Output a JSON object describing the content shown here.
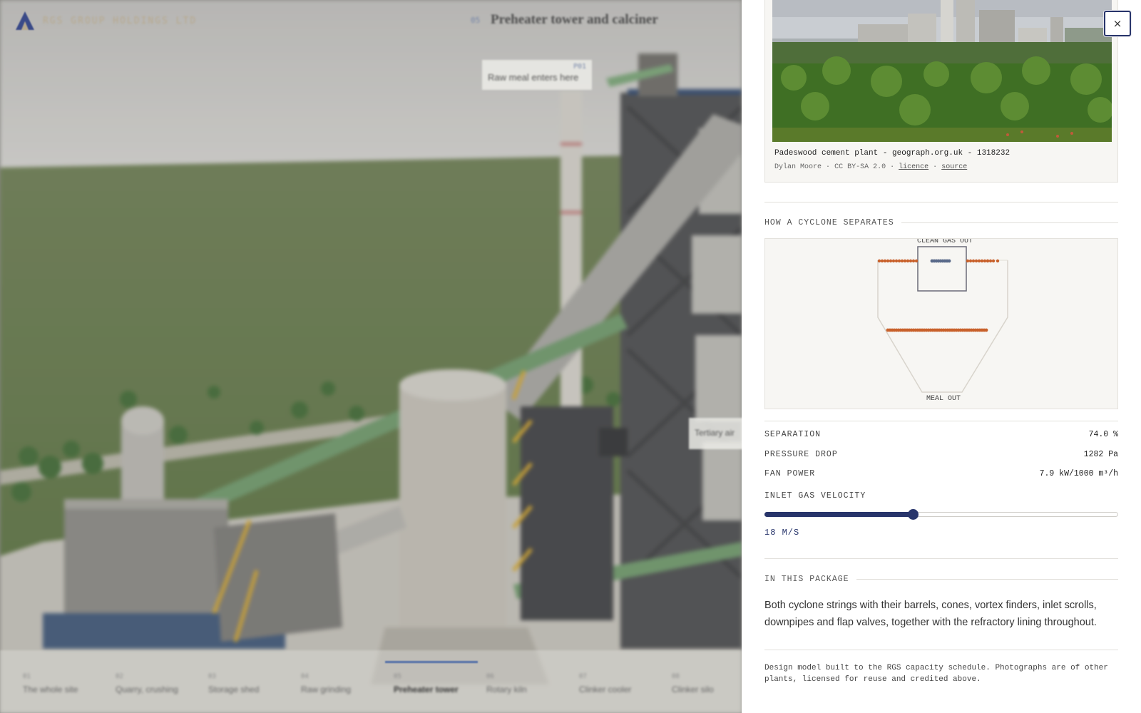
{
  "header": {
    "brand": "RGS GROUP HOLDINGS LTD",
    "section_number": "05",
    "section_title": "Preheater tower and calciner"
  },
  "callouts": [
    {
      "number": "P01",
      "text": "Raw meal enters here"
    },
    {
      "number": "",
      "text": "Tertiary air"
    }
  ],
  "bottom_nav": [
    {
      "number": "01",
      "label": "The whole site"
    },
    {
      "number": "02",
      "label": "Quarry, crushing"
    },
    {
      "number": "03",
      "label": "Storage shed"
    },
    {
      "number": "04",
      "label": "Raw grinding"
    },
    {
      "number": "05",
      "label": "Preheater tower"
    },
    {
      "number": "06",
      "label": "Rotary kiln"
    },
    {
      "number": "07",
      "label": "Clinker cooler"
    },
    {
      "number": "08",
      "label": "Clinker silo"
    }
  ],
  "active_nav_index": 4,
  "photo": {
    "caption": "Padeswood cement plant - geograph.org.uk - 1318232",
    "author": "Dylan Moore",
    "license": "CC BY-SA 2.0",
    "licence_link": "licence",
    "source_link": "source",
    "separator": "·"
  },
  "close_label": "×",
  "cyclone": {
    "heading": "HOW A CYCLONE SEPARATES",
    "top_label": "CLEAN GAS OUT",
    "bottom_label": "MEAL OUT",
    "colors": {
      "meal": "#c8602a",
      "gas": "#5a6a8a",
      "outline": "#d8d4cc",
      "finder": "#6a6a78"
    }
  },
  "metrics": [
    {
      "label": "SEPARATION",
      "value": "74.0 %"
    },
    {
      "label": "PRESSURE DROP",
      "value": "1282 Pa"
    },
    {
      "label": "FAN POWER",
      "value": "7.9 kW/1000 m³/h"
    }
  ],
  "slider": {
    "label": "INLET GAS VELOCITY",
    "value_text": "18 M/S",
    "fraction": 0.42
  },
  "package": {
    "heading": "IN THIS PACKAGE",
    "text": "Both cyclone strings with their barrels, cones, vortex finders, inlet scrolls, downpipes and flap valves, together with the refractory lining throughout."
  },
  "footnote": "Design model built to the RGS capacity schedule. Photographs are of other plants, licensed for reuse and credited above.",
  "colors": {
    "accent": "#28356b",
    "brand_gold": "#b7a98e"
  }
}
